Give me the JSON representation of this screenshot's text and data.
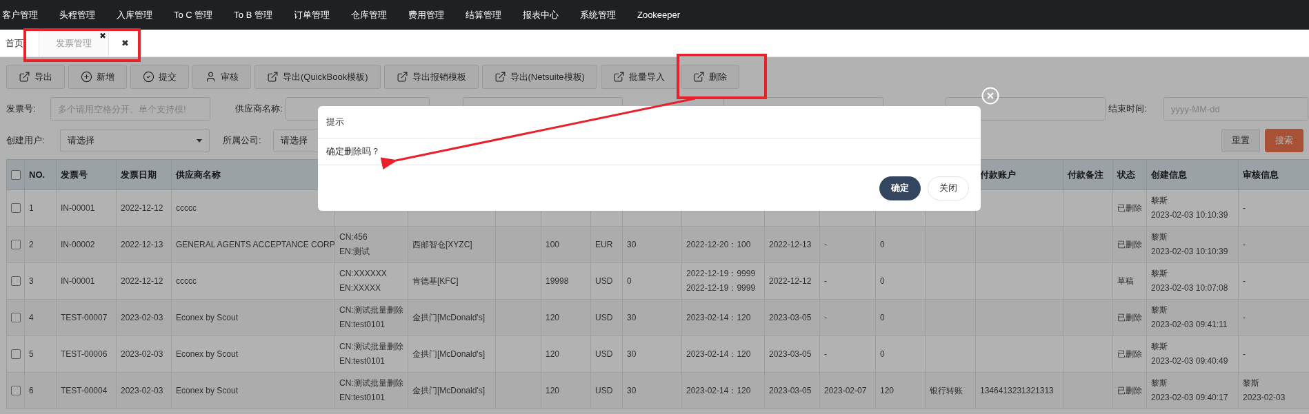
{
  "nav": {
    "items": [
      "客户管理",
      "头程管理",
      "入库管理",
      "To C 管理",
      "To B 管理",
      "订单管理",
      "仓库管理",
      "费用管理",
      "结算管理",
      "报表中心",
      "系统管理",
      "Zookeeper"
    ]
  },
  "tabs": [
    {
      "label": "首页",
      "closable": false,
      "selected": false
    },
    {
      "label": "发票管理",
      "closable": true,
      "selected": true
    }
  ],
  "tab_close_all": "✖",
  "tab_close_mark": "✖",
  "toolbar": [
    {
      "kind": "export",
      "label": "导出"
    },
    {
      "kind": "add",
      "label": "新增"
    },
    {
      "kind": "submit",
      "label": "提交"
    },
    {
      "kind": "audit",
      "label": "审核"
    },
    {
      "kind": "export",
      "label": "导出(QuickBook模板)"
    },
    {
      "kind": "export",
      "label": "导出报销模板"
    },
    {
      "kind": "export",
      "label": "导出(Netsuite模板)"
    },
    {
      "kind": "export",
      "label": "批量导入"
    },
    {
      "kind": "export",
      "label": "删除"
    }
  ],
  "filters_row_1": [
    {
      "kind": "text",
      "label": "发票号:",
      "placeholder": "多个请用空格分开。单个支持模!"
    },
    {
      "kind": "text",
      "label": "供应商名称:"
    },
    {
      "kind": "text"
    },
    {
      "kind": "text"
    },
    {
      "kind": "text"
    },
    {
      "kind": "text",
      "label": "结束时间:",
      "placeholder": "yyyy-MM-dd"
    }
  ],
  "filters_row_2": [
    {
      "kind": "select",
      "label": "创建用户:",
      "value": "请选择"
    },
    {
      "kind": "select",
      "label": "所属公司:",
      "value": "请选择"
    }
  ],
  "filter_buttons": [
    {
      "kind": "reset",
      "label": "重置"
    },
    {
      "kind": "search",
      "label": "搜索"
    }
  ],
  "table": {
    "all_checked": false,
    "columns": [
      "NO.",
      "发票号",
      "发票日期",
      "供应商名称",
      null,
      null,
      null,
      null,
      null,
      null,
      null,
      null,
      null,
      null,
      null,
      "付款账户",
      "付款备注",
      "状态",
      "创建信息",
      "审核信息"
    ],
    "rows": [
      {
        "checked": false,
        "cells": [
          "1",
          "IN-00001",
          "2022-12-12",
          "ccccc",
          null,
          null,
          null,
          null,
          null,
          null,
          null,
          null,
          null,
          null,
          null,
          null,
          null,
          "已删除",
          [
            "黎斯",
            "2023-02-03 10:10:39"
          ],
          "-"
        ]
      },
      {
        "checked": false,
        "cells": [
          "2",
          "IN-00002",
          "2022-12-13",
          "GENERAL AGENTS ACCEPTANCE CORP",
          [
            "CN:456",
            "EN:测试"
          ],
          "西邮智仓[XYZC]",
          null,
          "100",
          "EUR",
          "30",
          "2022-12-20：100",
          "2022-12-13",
          "-",
          "0",
          null,
          null,
          null,
          "已删除",
          [
            "黎斯",
            "2023-02-03 10:10:39"
          ],
          "-"
        ]
      },
      {
        "checked": false,
        "cells": [
          "3",
          "IN-00001",
          "2022-12-12",
          "ccccc",
          [
            "CN:XXXXXX",
            "EN:XXXXX"
          ],
          "肯德基[KFC]",
          null,
          "19998",
          "USD",
          "0",
          [
            "2022-12-19：9999",
            "2022-12-19：9999"
          ],
          "2022-12-12",
          "-",
          "0",
          null,
          null,
          null,
          "草稿",
          [
            "黎斯",
            "2023-02-03 10:07:08"
          ],
          "-"
        ]
      },
      {
        "checked": false,
        "cells": [
          "4",
          "TEST-00007",
          "2023-02-03",
          "Econex by Scout",
          [
            "CN:测试批量删除",
            "EN:test0101"
          ],
          "金拱门[McDonald's]",
          null,
          "120",
          "USD",
          "30",
          "2023-02-14：120",
          "2023-03-05",
          "-",
          "0",
          null,
          null,
          null,
          "已删除",
          [
            "黎斯",
            "2023-02-03 09:41:11"
          ],
          "-"
        ]
      },
      {
        "checked": false,
        "cells": [
          "5",
          "TEST-00006",
          "2023-02-03",
          "Econex by Scout",
          [
            "CN:测试批量删除",
            "EN:test0101"
          ],
          "金拱门[McDonald's]",
          null,
          "120",
          "USD",
          "30",
          "2023-02-14：120",
          "2023-03-05",
          "-",
          "0",
          null,
          null,
          null,
          "已删除",
          [
            "黎斯",
            "2023-02-03 09:40:49"
          ],
          "-"
        ]
      },
      {
        "checked": false,
        "cells": [
          "6",
          "TEST-00004",
          "2023-02-03",
          "Econex by Scout",
          [
            "CN:测试批量删除",
            "EN:test0101"
          ],
          "金拱门[McDonald's]",
          null,
          "120",
          "USD",
          "30",
          "2023-02-14：120",
          "2023-03-05",
          "2023-02-07",
          "120",
          "银行转账",
          "1346413231321313",
          null,
          "已删除",
          [
            "黎斯",
            "2023-02-03 09:40:17"
          ],
          [
            "黎斯",
            "2023-02-03"
          ]
        ]
      }
    ]
  },
  "dialog": {
    "title": "提示",
    "message": "确定删除吗？",
    "buttons": [
      {
        "kind": "primary",
        "label": "确定"
      },
      {
        "kind": "default",
        "label": "关闭"
      }
    ]
  }
}
